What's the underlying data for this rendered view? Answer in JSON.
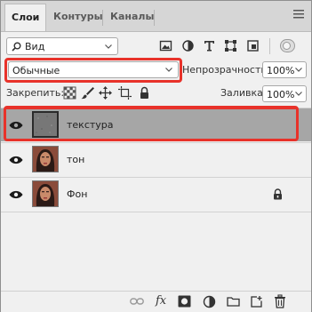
{
  "tabs": [
    {
      "label": "Слои",
      "active": true
    },
    {
      "label": "Контуры",
      "active": false
    },
    {
      "label": "Каналы",
      "active": false
    }
  ],
  "filter": {
    "label": "Вид"
  },
  "blend_mode": {
    "value": "Обычные"
  },
  "opacity": {
    "label": "Непрозрачность:",
    "value": "100%"
  },
  "lock": {
    "label": "Закрепить:"
  },
  "fill": {
    "label": "Заливка:",
    "value": "100%"
  },
  "layers": [
    {
      "name": "текстура",
      "selected": true,
      "locked": false,
      "thumb": "texture"
    },
    {
      "name": "тон",
      "selected": false,
      "locked": false,
      "thumb": "portrait"
    },
    {
      "name": "Фон",
      "selected": false,
      "locked": true,
      "thumb": "portrait"
    }
  ],
  "colors": {
    "accent_red": "#e8322a",
    "selected_row": "#a6a6a6"
  }
}
